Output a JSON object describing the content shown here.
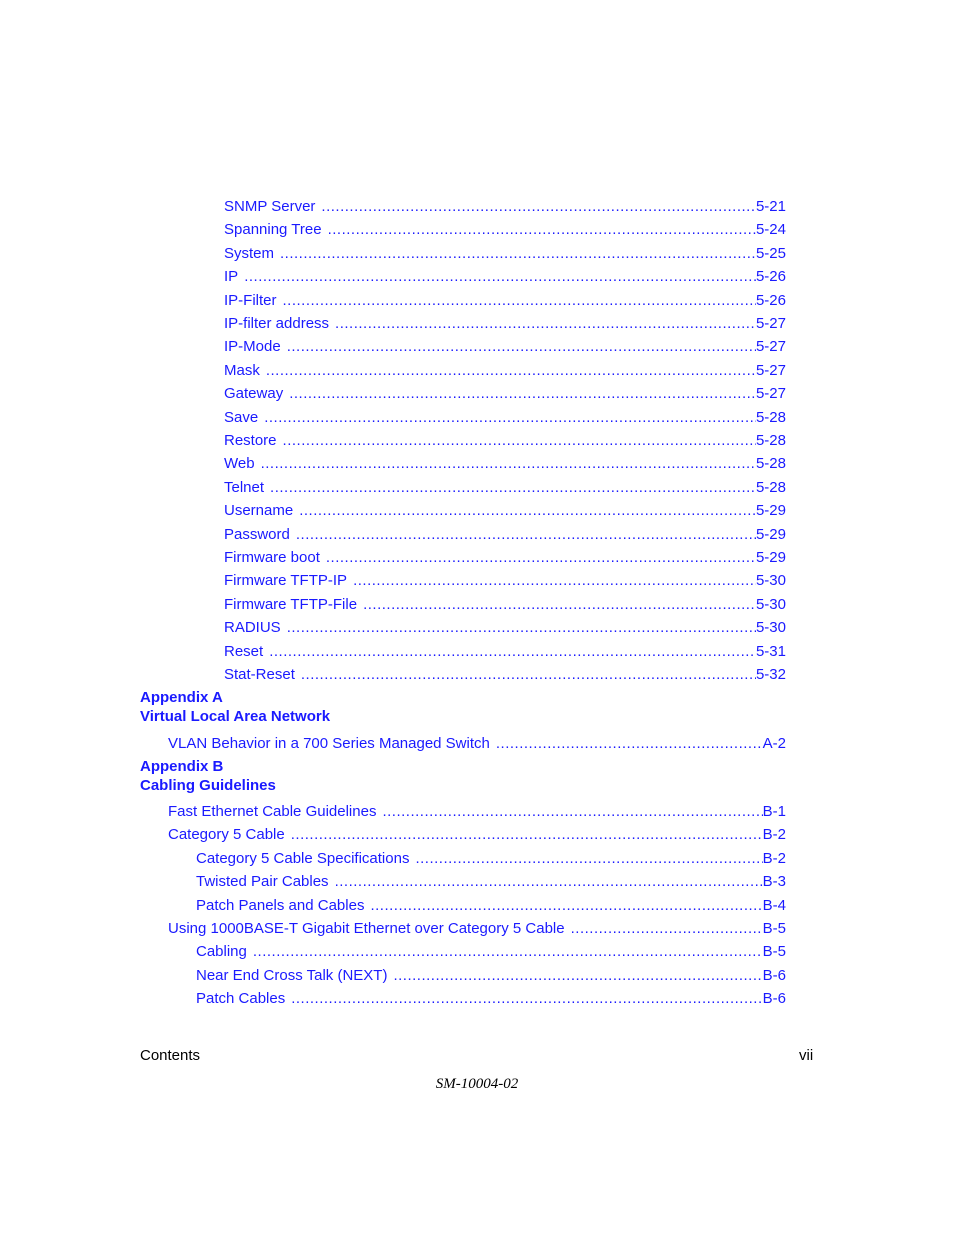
{
  "toc": {
    "entries_level3_chapter5": [
      {
        "label": "SNMP Server",
        "page": "5-21"
      },
      {
        "label": "Spanning Tree",
        "page": "5-24"
      },
      {
        "label": "System",
        "page": "5-25"
      },
      {
        "label": "IP",
        "page": "5-26"
      },
      {
        "label": "IP-Filter",
        "page": "5-26"
      },
      {
        "label": "IP-filter address",
        "page": "5-27"
      },
      {
        "label": "IP-Mode",
        "page": "5-27"
      },
      {
        "label": "Mask",
        "page": "5-27"
      },
      {
        "label": "Gateway",
        "page": "5-27"
      },
      {
        "label": "Save",
        "page": "5-28"
      },
      {
        "label": "Restore",
        "page": "5-28"
      },
      {
        "label": "Web",
        "page": "5-28"
      },
      {
        "label": "Telnet",
        "page": "5-28"
      },
      {
        "label": "Username",
        "page": "5-29"
      },
      {
        "label": "Password",
        "page": "5-29"
      },
      {
        "label": "Firmware boot",
        "page": "5-29"
      },
      {
        "label": "Firmware TFTP-IP",
        "page": "5-30"
      },
      {
        "label": "Firmware TFTP-File",
        "page": "5-30"
      },
      {
        "label": "RADIUS",
        "page": "5-30"
      },
      {
        "label": "Reset",
        "page": "5-31"
      },
      {
        "label": "Stat-Reset",
        "page": "5-32"
      }
    ],
    "appendix_a": {
      "label": "Appendix A",
      "title": "Virtual Local Area Network",
      "entries": [
        {
          "label": "VLAN Behavior in a 700 Series Managed Switch",
          "page": "A-2",
          "level": 1
        }
      ]
    },
    "appendix_b": {
      "label": "Appendix B",
      "title": "Cabling Guidelines",
      "entries": [
        {
          "label": "Fast Ethernet Cable Guidelines",
          "page": "B-1",
          "level": 1
        },
        {
          "label": "Category 5 Cable",
          "page": "B-2",
          "level": 1
        },
        {
          "label": "Category 5 Cable Specifications",
          "page": "B-2",
          "level": 2
        },
        {
          "label": "Twisted Pair Cables",
          "page": "B-3",
          "level": 2
        },
        {
          "label": "Patch Panels and Cables",
          "page": "B-4",
          "level": 2
        },
        {
          "label": "Using 1000BASE-T Gigabit Ethernet over Category 5 Cable",
          "page": "B-5",
          "level": 1
        },
        {
          "label": "Cabling",
          "page": "B-5",
          "level": 2
        },
        {
          "label": "Near End Cross Talk (NEXT)",
          "page": "B-6",
          "level": 2
        },
        {
          "label": "Patch Cables",
          "page": "B-6",
          "level": 2
        }
      ]
    }
  },
  "footer": {
    "section": "Contents",
    "page_number": "vii",
    "doc_id": "SM-10004-02"
  }
}
